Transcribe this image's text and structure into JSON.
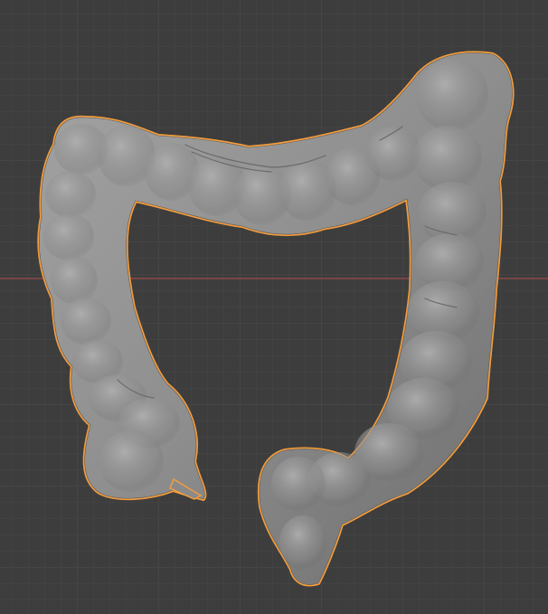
{
  "viewport": {
    "background_color": "#3d3d3d",
    "grid_minor_color": "#464646",
    "grid_major_color": "#4b4b4b",
    "x_axis_color": "#9c4848",
    "selection_outline_color": "#f39c3c",
    "mesh_color": "#8c8c8c"
  },
  "scene": {
    "object": {
      "icon": "mesh-object-icon",
      "selected": true,
      "shading": "solid"
    }
  }
}
